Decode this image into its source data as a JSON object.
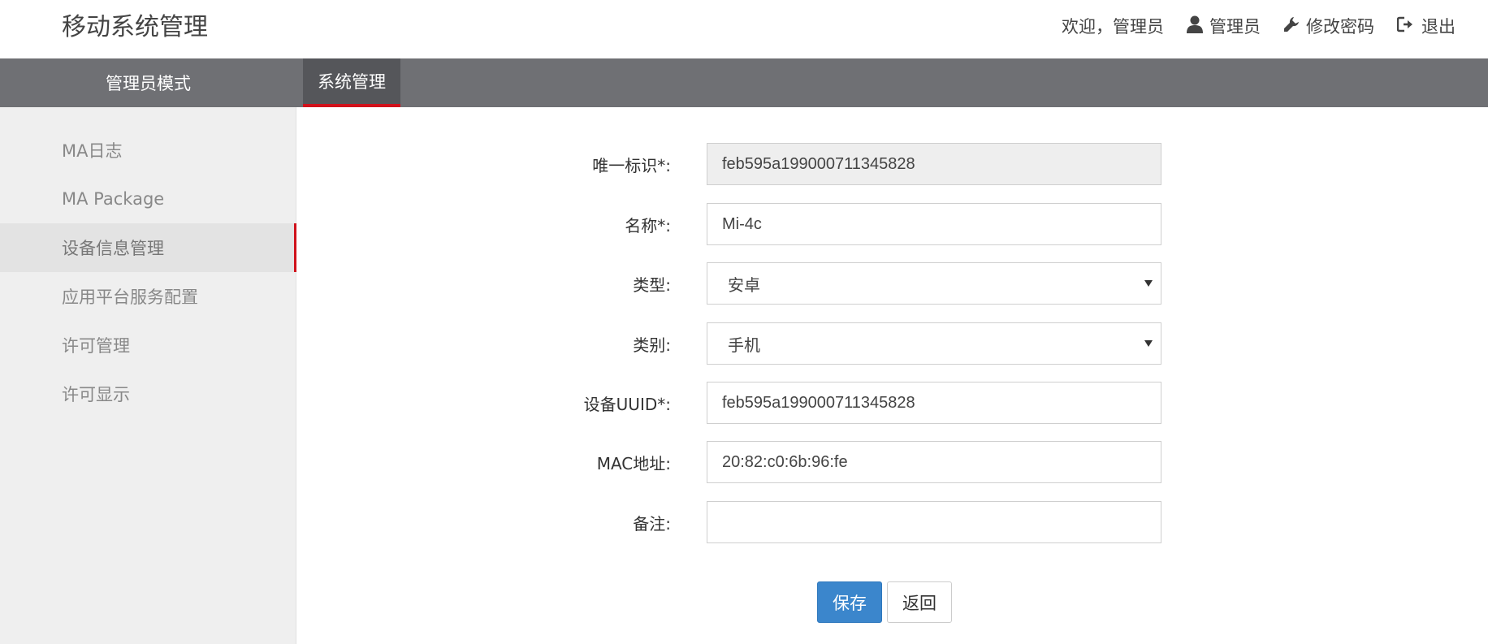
{
  "header": {
    "app_title": "移动系统管理",
    "welcome_text": "欢迎，管理员",
    "user_name": "管理员",
    "change_password": "修改密码",
    "logout": "退出"
  },
  "nav": {
    "mode_label": "管理员模式",
    "active_tab": "系统管理"
  },
  "sidebar": {
    "items": [
      {
        "label": "MA日志"
      },
      {
        "label": "MA Package"
      },
      {
        "label": "设备信息管理",
        "active": true
      },
      {
        "label": "应用平台服务配置"
      },
      {
        "label": "许可管理"
      },
      {
        "label": "许可显示"
      }
    ]
  },
  "form": {
    "unique_id": {
      "label": "唯一标识*:",
      "value": "feb595a199000711345828"
    },
    "name": {
      "label": "名称*:",
      "value": "Mi-4c"
    },
    "type": {
      "label": "类型:",
      "value": "安卓"
    },
    "category": {
      "label": "类别:",
      "value": "手机"
    },
    "uuid": {
      "label": "设备UUID*:",
      "value": "feb595a199000711345828"
    },
    "mac": {
      "label": "MAC地址:",
      "value": "20:82:c0:6b:96:fe"
    },
    "remark": {
      "label": "备注:",
      "value": ""
    }
  },
  "actions": {
    "save": "保存",
    "back": "返回"
  },
  "colors": {
    "accent_red": "#d0111b",
    "nav_bg": "#6f7074",
    "primary_blue": "#3b86cc"
  }
}
